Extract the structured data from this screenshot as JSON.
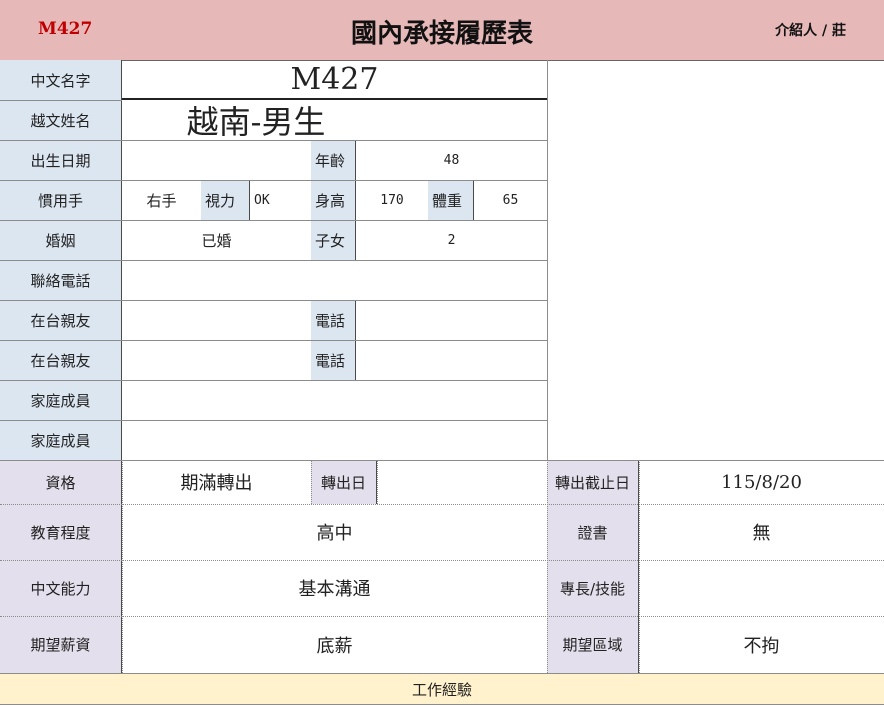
{
  "header": {
    "code": "M427",
    "title": "國內承接履歷表",
    "introducer": "介紹人 / 莊"
  },
  "labels": {
    "chinese_name": "中文名字",
    "vn_name": "越文姓名",
    "birth": "出生日期",
    "age": "年齡",
    "hand": "慣用手",
    "vision": "視力",
    "height": "身高",
    "weight": "體重",
    "marriage": "婚姻",
    "children": "子女",
    "contact": "聯絡電話",
    "relative1": "在台親友",
    "phone1": "電話",
    "relative2": "在台親友",
    "phone2": "電話",
    "family1": "家庭成員",
    "family2": "家庭成員",
    "qualification": "資格",
    "transfer_date": "轉出日",
    "transfer_deadline": "轉出截止日",
    "education": "教育程度",
    "certificate": "證書",
    "chinese_ability": "中文能力",
    "skills": "專長/技能",
    "salary": "期望薪資",
    "region": "期望區域",
    "work_experience": "工作經驗"
  },
  "values": {
    "chinese_name": "M427",
    "vn_name": "越南-男生",
    "birth": "",
    "age": "48",
    "hand": "右手",
    "vision": "OK",
    "height": "170",
    "weight": "65",
    "marriage": "已婚",
    "children": "2",
    "contact": "",
    "relative1": "",
    "phone1": "",
    "relative2": "",
    "phone2": "",
    "family1": "",
    "family2": "",
    "qualification": "期滿轉出",
    "transfer_date": "",
    "transfer_deadline": "115/8/20",
    "education": "高中",
    "certificate": "無",
    "chinese_ability": "基本溝通",
    "skills": "",
    "salary": "底薪",
    "region": "不拘"
  },
  "colors": {
    "header_bg": "#e6b8b7",
    "header_code": "#c00000",
    "label_blue": "#dce6f1",
    "label_purple": "#e4dfec",
    "work_bg": "#fff2cc"
  }
}
